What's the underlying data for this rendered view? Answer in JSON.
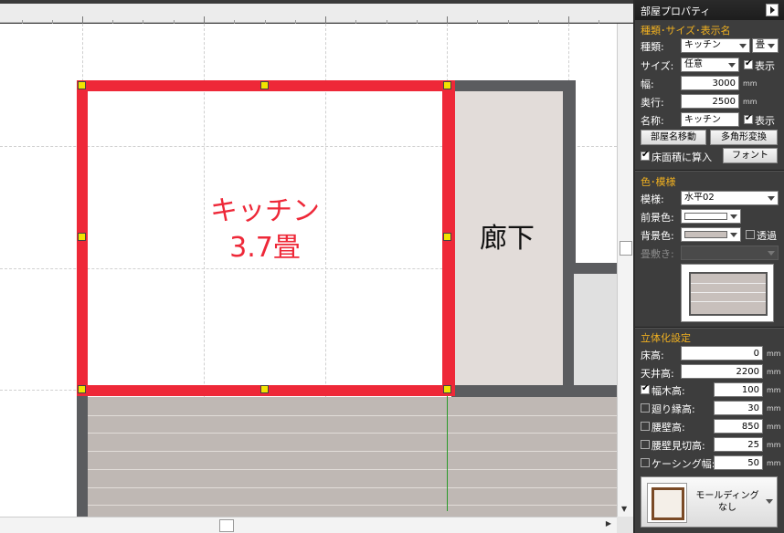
{
  "canvas": {
    "room_name": "キッチン",
    "room_area": "3.7畳",
    "hallway_name": "廊下"
  },
  "panel": {
    "title": "部屋プロパティ",
    "sections": {
      "type_size_name": "種類･サイズ･表示名",
      "color_pattern": "色･模様",
      "3d": "立体化設定"
    },
    "type": {
      "label": "種類:",
      "value": "キッチン",
      "unit_value": "畳"
    },
    "size": {
      "label": "サイズ:",
      "value": "任意",
      "show_label": "表示"
    },
    "width": {
      "label": "幅:",
      "value": "3000",
      "unit": "mm"
    },
    "depth": {
      "label": "奥行:",
      "value": "2500",
      "unit": "mm"
    },
    "name": {
      "label": "名称:",
      "value": "キッチン",
      "show_label": "表示"
    },
    "move_name_button": "部屋名移動",
    "polygon_button": "多角形変換",
    "include_floor_area": "床面積に算入",
    "font_button": "フォント",
    "pattern": {
      "label": "模様:",
      "value": "水平02"
    },
    "fg_color": {
      "label": "前景色:",
      "color": "#ffffff"
    },
    "bg_color": {
      "label": "背景色:",
      "color": "#c8c0bc",
      "transparent_label": "透過"
    },
    "tatami_label": "畳敷き:",
    "floor_height": {
      "label": "床高:",
      "value": "0",
      "unit": "mm"
    },
    "ceiling_height": {
      "label": "天井高:",
      "value": "2200",
      "unit": "mm"
    },
    "baseboard": {
      "label": "幅木高:",
      "value": "100",
      "unit": "mm",
      "checked": true
    },
    "cornice": {
      "label": "廻り縁高:",
      "value": "30",
      "unit": "mm",
      "checked": false
    },
    "wainscot": {
      "label": "腰壁高:",
      "value": "850",
      "unit": "mm",
      "checked": false
    },
    "wainscot_trim": {
      "label": "腰壁見切高:",
      "value": "25",
      "unit": "mm",
      "checked": false
    },
    "casing": {
      "label": "ケーシング幅:",
      "value": "50",
      "unit": "mm",
      "checked": false
    },
    "molding": {
      "line1": "モールディング",
      "line2": "なし"
    }
  },
  "colors": {
    "selected_wall": "#ee2838",
    "wall": "#5b5c5f",
    "hallway_floor": "#e2dcd9",
    "floor_pattern": "#bfb8b4",
    "section_header": "#f0b020"
  }
}
